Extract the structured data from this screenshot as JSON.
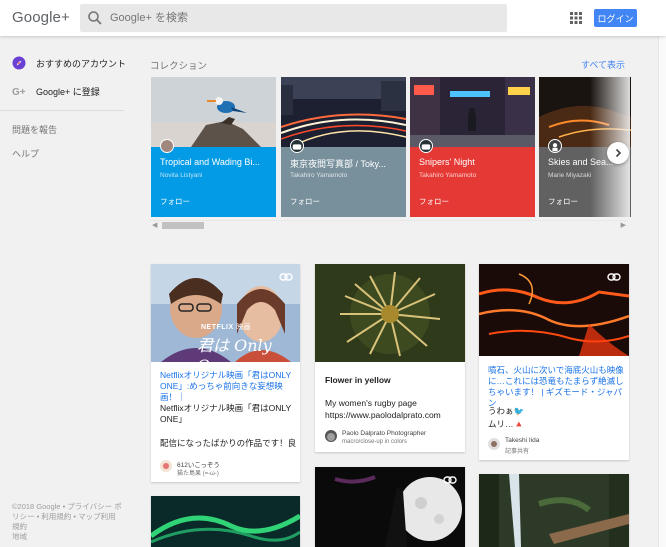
{
  "header": {
    "logo": "Google+",
    "search_placeholder": "Google+ を検索",
    "login_label": "ログイン"
  },
  "sidebar": {
    "items": [
      {
        "label": "おすすめのアカウント",
        "icon": "compass-icon"
      },
      {
        "label": "Google+ に登録",
        "icon": "google-plus-icon"
      }
    ],
    "links": [
      "問題を報告",
      "ヘルプ"
    ],
    "footer": "©2018 Google • プライバシー ポリシー • 利用規約 • マップ利用規約",
    "footer_extra": "地域"
  },
  "collections": {
    "title": "コレクション",
    "show_all": "すべて表示",
    "follow_label": "フォロー",
    "items": [
      {
        "name": "Tropical and Wading Bi...",
        "owner": "Novita Listyani",
        "color": "#039be5"
      },
      {
        "name": "東京夜間写真部 / Toky...",
        "owner": "Takahiro Yamamoto",
        "color": "#78909c"
      },
      {
        "name": "Snipers' Night",
        "owner": "Takahiro Yamamoto",
        "color": "#e53935"
      },
      {
        "name": "Skies and Sea...",
        "owner": "Marie Miyazaki",
        "color": "#616161"
      }
    ]
  },
  "posts": {
    "netflix": {
      "image_brand": "NETFLIX",
      "image_brand_sub": "映画",
      "image_title": "君は Only One",
      "link_text": "Netflixオリジナル映画「君はONLY ONE」:めっちゃ前向きな妄想映画！｜",
      "body1": "Netflixオリジナル映画「君はONLY ONE」",
      "body2": "配信になったばかりの作品です！良",
      "author": "612いこっぞう",
      "author_sub": "猫た島果 (=-ω-)"
    },
    "flower": {
      "title": "Flower in yellow",
      "body_bold": "My women's rugby page",
      "body_url": "https://www.paolodalprato.com",
      "author": "Paolo Dalprato Photographer",
      "author_sub": "macro/close-up in colors"
    },
    "lava": {
      "link_text": "噴石、火山に次いで海底火山も映像に…これには恐竜もたまらず絶滅しちゃいます！ | ギズモード・ジャパン",
      "body1": "うわぁ🐦",
      "body2": "ムリ…🔺",
      "author": "Takeshi Iida",
      "author_sub": "記事共有"
    }
  }
}
